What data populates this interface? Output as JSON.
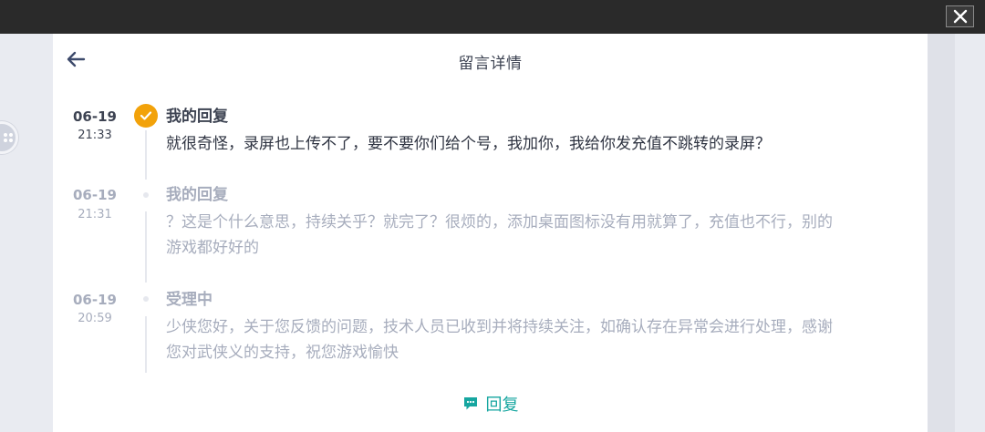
{
  "title": "留言详情",
  "entries": [
    {
      "date": "06-19",
      "time": "21:33",
      "status": "我的回复",
      "message": "就很奇怪，录屏也上传不了，要不要你们给个号，我加你，我给你发充值不跳转的录屏？",
      "active": true
    },
    {
      "date": "06-19",
      "time": "21:31",
      "status": "我的回复",
      "message_line1": "？这是个什么意思，持续关乎？就完了？很烦的，添加桌面图标没有用就算了，充值也不行，别的",
      "message_line2": "游戏都好好的",
      "active": false
    },
    {
      "date": "06-19",
      "time": "20:59",
      "status": "受理中",
      "message_line1": "少侠您好，关于您反馈的问题，技术人员已收到并将持续关注，如确认存在异常会进行处理，感谢",
      "message_line2": "您对武侠义的支持，祝您游戏愉快",
      "active": false
    }
  ],
  "reply_label": "回复",
  "icons": {
    "close": "close-icon",
    "back": "arrow-left-icon",
    "check": "check-icon",
    "reply": "chat-bubble-icon"
  },
  "colors": {
    "accent_orange": "#f2a20a",
    "accent_teal": "#16a6a0",
    "text_dark": "#3d4352",
    "text_muted": "#a7adbd"
  }
}
